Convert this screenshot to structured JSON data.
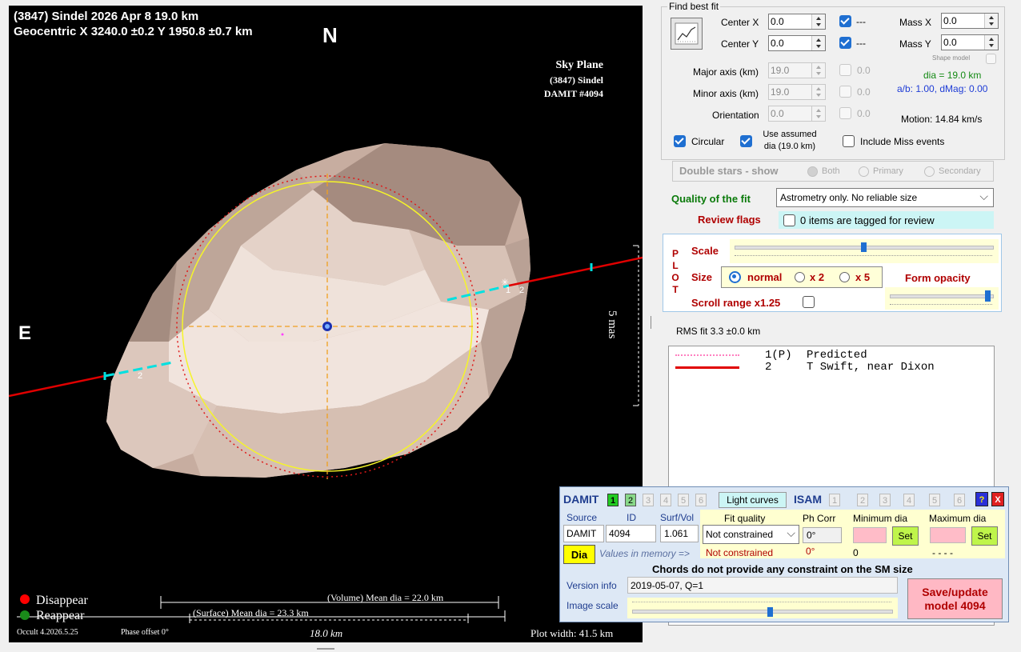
{
  "plot": {
    "title_line1": "(3847) Sindel  2026 Apr 8   19.0 km",
    "title_line2": "Geocentric  X  3240.0 ±0.2  Y  1950.8 ±0.7 km",
    "north_label": "N",
    "east_label": "E",
    "sky_plane_1": "Sky Plane",
    "sky_plane_2": "(3847) Sindel",
    "sky_plane_3": "DAMIT #4094",
    "scale_mas": "5 mas",
    "chord_label_left": "2",
    "chord_label_right_1": "1",
    "chord_label_right_2": "2",
    "legend_disappear": "Disappear",
    "legend_reappear": "Reappear",
    "volume_dia": "(Volume) Mean dia = 22.0 km",
    "surface_dia": "(Surface) Mean dia = 23.3 km",
    "version": "Occult 4.2026.5.25",
    "phase_offset": "Phase offset 0°",
    "scale_km": "18.0 km",
    "plot_width": "Plot width: 41.5 km",
    "colors": {
      "disappear": "#ff0000",
      "reappear": "#1a8a1a",
      "chord": "#e00000",
      "chord_dash": "#00e5e5",
      "fit_circle": "#ffff33"
    }
  },
  "fit": {
    "group_label": "Find best fit",
    "fit_button_icon": "chart-icon",
    "center_x_label": "Center X",
    "center_x_value": "0.0",
    "center_y_label": "Center Y",
    "center_y_value": "0.0",
    "center_x_check_label": "---",
    "center_y_check_label": "---",
    "mass_x_label": "Mass X",
    "mass_x_value": "0.0",
    "mass_y_label": "Mass Y",
    "mass_y_value": "0.0",
    "shape_model_label": "Shape model",
    "major_label": "Major axis (km)",
    "major_value": "19.0",
    "major_check_label": "0.0",
    "minor_label": "Minor axis (km)",
    "minor_value": "19.0",
    "minor_check_label": "0.0",
    "orient_label": "Orientation",
    "orient_value": "0.0",
    "orient_check_label": "0.0",
    "dia_text": "dia = 19.0 km",
    "ab_text": "a/b: 1.00, dMag: 0.00",
    "motion_text": "Motion: 14.84 km/s",
    "circular_label": "Circular",
    "use_assumed_1": "Use assumed",
    "use_assumed_2": "dia (19.0 km)",
    "include_miss_label": "Include Miss events",
    "double_stars_label": "Double stars - show",
    "both_label": "Both",
    "primary_label": "Primary",
    "secondary_label": "Secondary",
    "quality_label": "Quality of the fit",
    "quality_value": "Astrometry only. No reliable size",
    "review_label": "Review flags",
    "review_value": "0 items are tagged for review"
  },
  "plotpanel": {
    "plot_letters": [
      "P",
      "L",
      "O",
      "T"
    ],
    "scale_label": "Scale",
    "scale_level": 0.5,
    "size_label": "Size",
    "normal_label": "normal",
    "x2_label": "x 2",
    "x5_label": "x 5",
    "form_opacity_label": "Form opacity",
    "form_opacity_level": 0.95,
    "scroll_label": "Scroll range x1.25"
  },
  "rms": "RMS fit 3.3 ±0.0 km",
  "legend_list": [
    {
      "num": "1(P)",
      "text": "Predicted"
    },
    {
      "num": "2",
      "text": "T Swift, near Dixon"
    }
  ],
  "damit": {
    "title": "DAMIT",
    "model_nums": [
      "1",
      "2",
      "3",
      "4",
      "5",
      "6"
    ],
    "light_curves": "Light curves",
    "isam_title": "ISAM",
    "isam_nums": [
      "1",
      "2",
      "3",
      "4",
      "5",
      "6"
    ],
    "help_icon": "?",
    "close_icon": "X",
    "col_source": "Source",
    "col_id": "ID",
    "col_surfvol": "Surf/Vol",
    "col_fit": "Fit quality",
    "col_phcorr": "Ph Corr",
    "col_min": "Minimum dia",
    "col_max": "Maximum dia",
    "source_value": "DAMIT",
    "id_value": "4094",
    "surfvol_value": "1.061",
    "fit_value": "Not constrained",
    "phcorr_value": "0°",
    "set_label": "Set",
    "dia_button": "Dia",
    "values_memory": "Values in memory =>",
    "mem_fit": "Not constrained",
    "mem_ph": "0°",
    "mem_min": "0",
    "mem_max": "- - - -",
    "chords_note": "Chords do not provide any constraint on the SM size",
    "version_label": "Version info",
    "version_value": "2019-05-07, Q=1",
    "image_scale_label": "Image scale",
    "image_scale_level": 0.53,
    "save_1": "Save/update",
    "save_2": "model 4094"
  }
}
